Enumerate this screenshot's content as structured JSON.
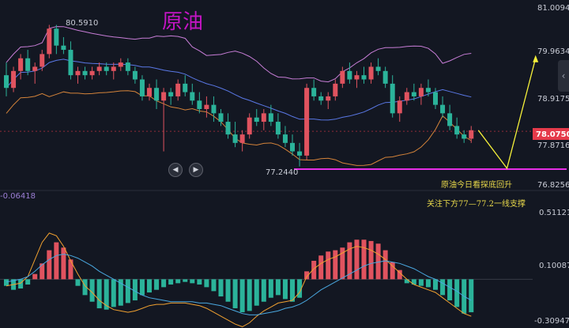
{
  "chart_data": [
    {
      "type": "candlestick",
      "title": "原油",
      "price_axis_ticks": [
        "81.0094",
        "79.9634",
        "78.9175",
        "77.8716",
        "76.8256"
      ],
      "tick_values": [
        81.0094,
        79.9634,
        78.9175,
        77.8716,
        76.8256
      ],
      "current_price": "78.0750",
      "high_label": "80.5910",
      "low_label": "77.2440",
      "support_level": 77.2,
      "annotations": [
        "原油今日看探底回升",
        "关注下方77—77.2一线支撑"
      ],
      "ylim": [
        76.7,
        81.05
      ],
      "candles": [
        [
          79.4,
          79.7,
          78.9,
          79.1
        ],
        [
          79.1,
          79.6,
          79.0,
          79.5
        ],
        [
          79.5,
          79.9,
          79.3,
          79.8
        ],
        [
          79.8,
          80.0,
          79.4,
          79.5
        ],
        [
          79.5,
          79.7,
          79.2,
          79.6
        ],
        [
          79.6,
          80.0,
          79.5,
          79.9
        ],
        [
          79.9,
          80.59,
          79.8,
          80.5
        ],
        [
          80.5,
          80.59,
          79.9,
          80.1
        ],
        [
          80.1,
          80.3,
          79.9,
          80.0
        ],
        [
          80.0,
          80.2,
          79.3,
          79.4
        ],
        [
          79.4,
          79.6,
          79.2,
          79.5
        ],
        [
          79.5,
          79.6,
          79.3,
          79.4
        ],
        [
          79.4,
          79.6,
          79.3,
          79.5
        ],
        [
          79.5,
          79.7,
          79.4,
          79.6
        ],
        [
          79.6,
          79.7,
          79.4,
          79.5
        ],
        [
          79.5,
          79.7,
          79.3,
          79.6
        ],
        [
          79.6,
          79.8,
          79.5,
          79.7
        ],
        [
          79.7,
          79.8,
          79.4,
          79.5
        ],
        [
          79.5,
          79.6,
          79.2,
          79.3
        ],
        [
          79.3,
          79.4,
          78.8,
          78.9
        ],
        [
          78.9,
          79.2,
          78.8,
          79.1
        ],
        [
          79.1,
          79.3,
          78.6,
          78.8
        ],
        [
          78.8,
          79.1,
          77.6,
          79.0
        ],
        [
          79.0,
          79.1,
          78.7,
          78.9
        ],
        [
          78.9,
          79.3,
          78.8,
          79.2
        ],
        [
          79.2,
          79.4,
          78.9,
          79.0
        ],
        [
          79.0,
          79.2,
          78.7,
          78.8
        ],
        [
          78.8,
          79.0,
          78.5,
          78.6
        ],
        [
          78.6,
          78.9,
          78.4,
          78.7
        ],
        [
          78.7,
          78.9,
          78.3,
          78.5
        ],
        [
          78.5,
          78.6,
          78.2,
          78.3
        ],
        [
          78.3,
          78.5,
          77.9,
          78.0
        ],
        [
          78.0,
          78.3,
          77.7,
          77.8
        ],
        [
          77.8,
          78.1,
          77.6,
          78.0
        ],
        [
          78.0,
          78.5,
          77.9,
          78.4
        ],
        [
          78.4,
          78.6,
          78.2,
          78.3
        ],
        [
          78.3,
          78.6,
          78.1,
          78.5
        ],
        [
          78.5,
          78.7,
          78.2,
          78.3
        ],
        [
          78.3,
          78.5,
          77.9,
          78.0
        ],
        [
          78.0,
          78.2,
          77.7,
          77.8
        ],
        [
          77.8,
          78.0,
          77.5,
          77.6
        ],
        [
          77.6,
          77.8,
          77.244,
          77.5
        ],
        [
          77.5,
          79.2,
          77.4,
          79.1
        ],
        [
          79.1,
          79.3,
          78.8,
          78.9
        ],
        [
          78.9,
          79.0,
          78.7,
          78.8
        ],
        [
          78.8,
          79.0,
          78.6,
          78.9
        ],
        [
          78.9,
          79.3,
          78.8,
          79.2
        ],
        [
          79.2,
          79.6,
          79.1,
          79.5
        ],
        [
          79.5,
          79.7,
          79.2,
          79.3
        ],
        [
          79.3,
          79.5,
          79.1,
          79.4
        ],
        [
          79.4,
          79.6,
          79.2,
          79.3
        ],
        [
          79.3,
          79.7,
          79.2,
          79.6
        ],
        [
          79.6,
          79.8,
          79.4,
          79.5
        ],
        [
          79.5,
          79.6,
          79.1,
          79.2
        ],
        [
          79.2,
          79.4,
          78.4,
          78.5
        ],
        [
          78.5,
          78.9,
          78.3,
          78.8
        ],
        [
          78.8,
          79.1,
          78.7,
          79.0
        ],
        [
          79.0,
          79.2,
          78.8,
          78.9
        ],
        [
          78.9,
          79.2,
          78.7,
          79.1
        ],
        [
          79.1,
          79.3,
          78.9,
          79.0
        ],
        [
          79.0,
          79.1,
          78.6,
          78.7
        ],
        [
          78.7,
          78.9,
          78.4,
          78.5
        ],
        [
          78.5,
          78.7,
          78.1,
          78.2
        ],
        [
          78.2,
          78.4,
          77.9,
          78.0
        ],
        [
          78.0,
          78.1,
          77.8,
          77.9
        ],
        [
          77.9,
          78.2,
          77.8,
          78.1
        ]
      ],
      "projection": [
        [
          66,
          78.1
        ],
        [
          70,
          77.2
        ],
        [
          74,
          79.8
        ]
      ]
    },
    {
      "type": "bar",
      "indicator_value": "-0.06418",
      "axis_ticks": [
        "0.51121",
        "0.10087",
        "-0.30947"
      ],
      "tick_values": [
        0.51121,
        0.10087,
        -0.30947
      ],
      "zero_level": 0.0,
      "ylim": [
        -0.34,
        0.62
      ],
      "histogram": [
        -0.05,
        -0.08,
        -0.07,
        -0.04,
        0.04,
        0.12,
        0.22,
        0.28,
        0.24,
        0.15,
        -0.05,
        -0.12,
        -0.17,
        -0.22,
        -0.23,
        -0.21,
        -0.2,
        -0.18,
        -0.16,
        -0.12,
        -0.1,
        -0.08,
        -0.06,
        -0.04,
        -0.03,
        -0.02,
        -0.03,
        -0.04,
        -0.06,
        -0.09,
        -0.13,
        -0.17,
        -0.22,
        -0.25,
        -0.24,
        -0.2,
        -0.17,
        -0.14,
        -0.12,
        -0.15,
        -0.17,
        -0.14,
        0.06,
        0.14,
        0.18,
        0.21,
        0.22,
        0.24,
        0.28,
        0.3,
        0.3,
        0.29,
        0.27,
        0.22,
        0.13,
        0.07,
        -0.03,
        -0.04,
        -0.05,
        -0.06,
        -0.08,
        -0.12,
        -0.16,
        -0.21,
        -0.26,
        -0.25
      ],
      "dif": [
        -0.05,
        -0.04,
        -0.03,
        0.02,
        0.15,
        0.28,
        0.35,
        0.33,
        0.25,
        0.14,
        0.04,
        -0.05,
        -0.1,
        -0.16,
        -0.2,
        -0.23,
        -0.24,
        -0.25,
        -0.24,
        -0.22,
        -0.2,
        -0.19,
        -0.19,
        -0.18,
        -0.18,
        -0.18,
        -0.19,
        -0.2,
        -0.22,
        -0.25,
        -0.28,
        -0.31,
        -0.34,
        -0.36,
        -0.33,
        -0.28,
        -0.24,
        -0.21,
        -0.18,
        -0.17,
        -0.16,
        -0.1,
        0.02,
        0.08,
        0.12,
        0.15,
        0.17,
        0.2,
        0.23,
        0.25,
        0.24,
        0.22,
        0.19,
        0.15,
        0.1,
        0.05,
        0.0,
        -0.04,
        -0.06,
        -0.08,
        -0.1,
        -0.14,
        -0.18,
        -0.22,
        -0.26,
        -0.28
      ],
      "dea": [
        -0.02,
        -0.01,
        0.0,
        0.02,
        0.06,
        0.11,
        0.15,
        0.18,
        0.19,
        0.18,
        0.16,
        0.13,
        0.1,
        0.06,
        0.03,
        0.0,
        -0.03,
        -0.06,
        -0.09,
        -0.12,
        -0.14,
        -0.15,
        -0.16,
        -0.17,
        -0.17,
        -0.17,
        -0.17,
        -0.18,
        -0.18,
        -0.19,
        -0.2,
        -0.22,
        -0.24,
        -0.26,
        -0.27,
        -0.27,
        -0.26,
        -0.25,
        -0.24,
        -0.22,
        -0.21,
        -0.19,
        -0.16,
        -0.12,
        -0.08,
        -0.05,
        -0.02,
        0.01,
        0.04,
        0.07,
        0.1,
        0.12,
        0.13,
        0.14,
        0.13,
        0.12,
        0.1,
        0.08,
        0.05,
        0.02,
        0.0,
        -0.03,
        -0.06,
        -0.09,
        -0.13,
        -0.16
      ]
    }
  ]
}
